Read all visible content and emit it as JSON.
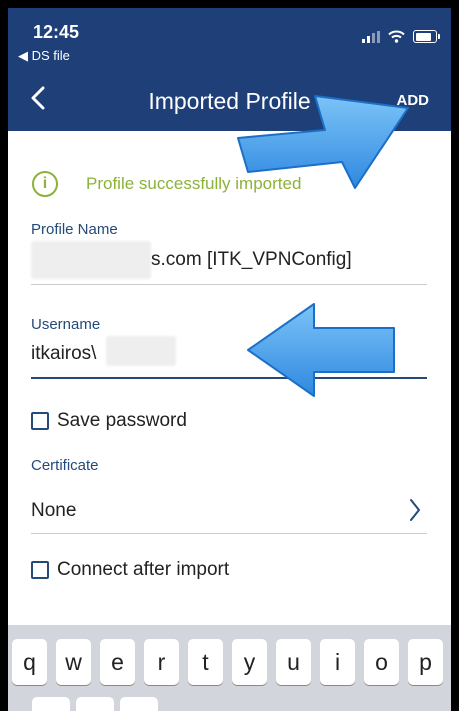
{
  "status_bar": {
    "time": "12:45",
    "back_app": "◀ DS file"
  },
  "nav": {
    "title": "Imported Profile",
    "add_label": "ADD"
  },
  "banner": {
    "text": "Profile successfully imported"
  },
  "profile_name": {
    "label": "Profile Name",
    "value_suffix": "s.com [ITK_VPNConfig]"
  },
  "username": {
    "label": "Username",
    "value": "itkairos\\"
  },
  "save_password": {
    "label": "Save password",
    "checked": false
  },
  "certificate": {
    "label": "Certificate",
    "value": "None"
  },
  "connect_after_import": {
    "label": "Connect after import",
    "checked": false
  },
  "keyboard": {
    "row1": [
      "q",
      "w",
      "e",
      "r",
      "t",
      "y",
      "u",
      "i",
      "o",
      "p"
    ]
  },
  "colors": {
    "header": "#1e3f77",
    "success": "#8cb23a",
    "arrow": "#4aa3f0"
  }
}
